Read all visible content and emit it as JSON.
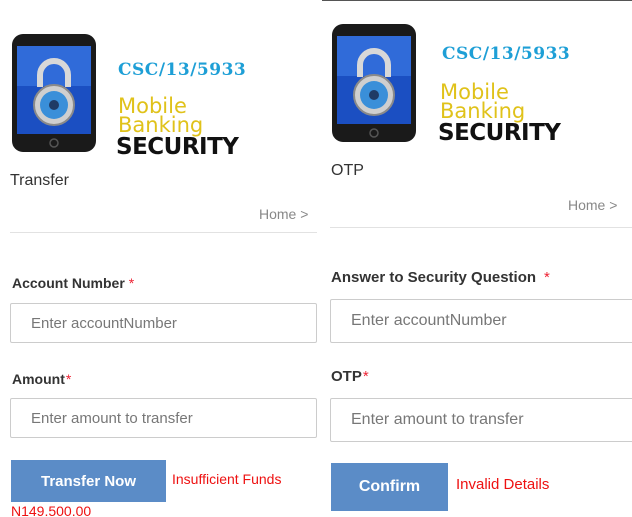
{
  "logo": {
    "code": "CSC/13/5933",
    "line1": "Mobile",
    "line2": "Banking",
    "line3": "SECURITY",
    "icon": "padlock-phone-icon"
  },
  "colors": {
    "accent": "#5b8cc7",
    "error": "#ee1111",
    "required": "#ee2233",
    "logo_code": "#1e9fd6",
    "logo_mobile": "#e0c21a"
  },
  "left": {
    "title": "Transfer",
    "breadcrumb": "Home >",
    "fields": [
      {
        "label": "Account Number",
        "required_mark": "*",
        "placeholder": "Enter accountNumber",
        "value": ""
      },
      {
        "label": "Amount",
        "required_mark": "*",
        "placeholder": "Enter amount to transfer",
        "value": ""
      }
    ],
    "submit_label": "Transfer Now",
    "error": "Insufficient Funds",
    "balance": "N149,500.00"
  },
  "right": {
    "title": "OTP",
    "breadcrumb": "Home >",
    "fields": [
      {
        "label": "Answer to Security Question",
        "required_mark": "*",
        "placeholder": "Enter accountNumber",
        "value": ""
      },
      {
        "label": "OTP",
        "required_mark": "*",
        "placeholder": "Enter amount to transfer",
        "value": ""
      }
    ],
    "submit_label": "Confirm",
    "error": "Invalid Details"
  }
}
